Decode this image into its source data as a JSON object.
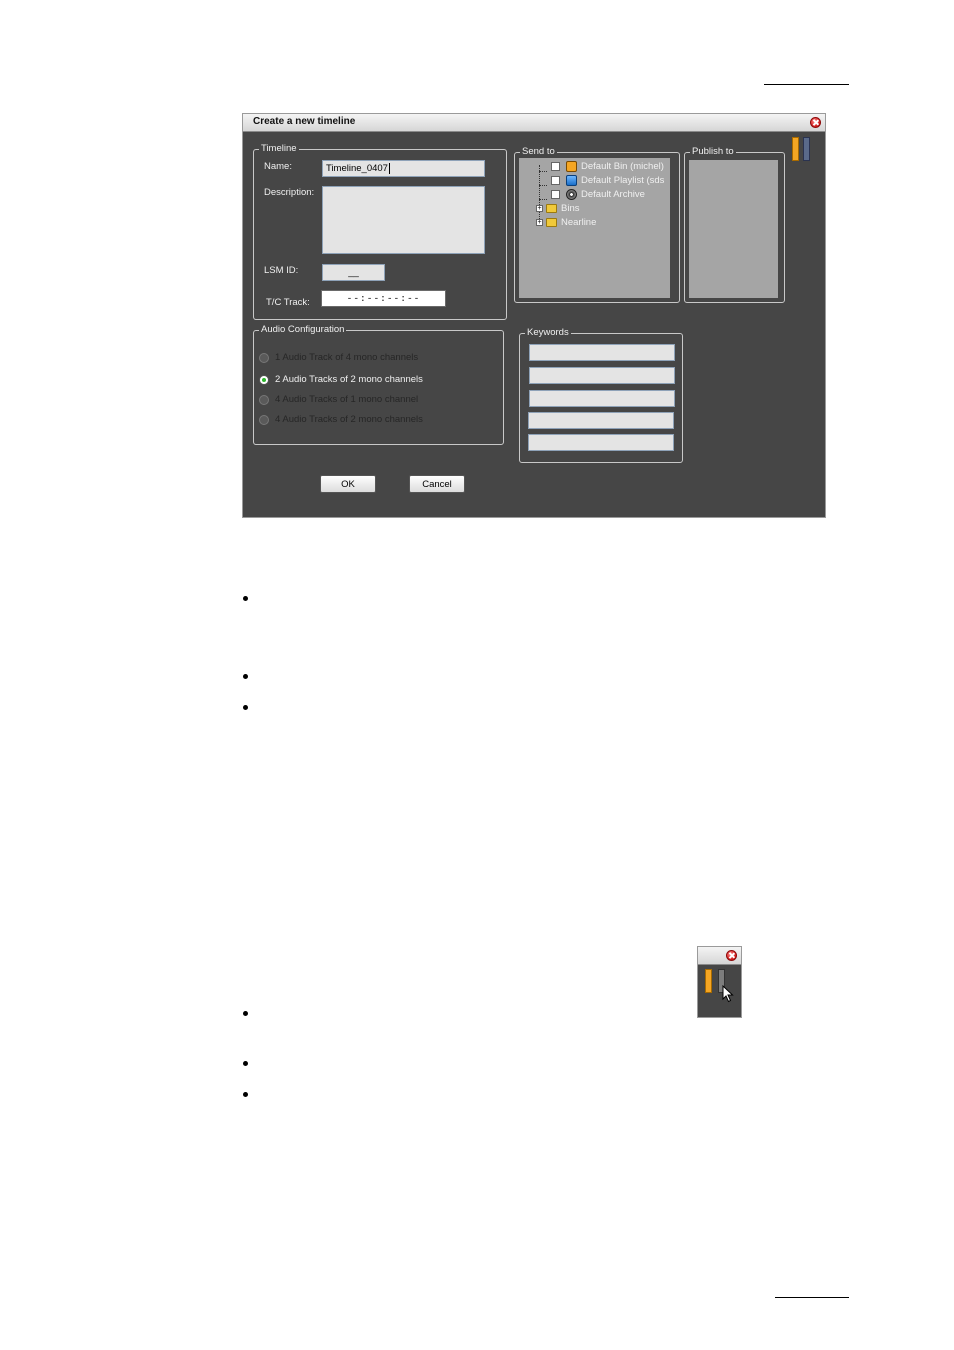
{
  "dialog": {
    "title": "Create a new timeline",
    "timeline_group": {
      "legend": "Timeline",
      "name_label": "Name:",
      "name_value": "Timeline_0407",
      "description_label": "Description:",
      "description_value": "",
      "lsm_id_label": "LSM ID:",
      "lsm_id_value": "__",
      "tc_track_label": "T/C Track:",
      "tc_track_value": "--:--:--:--"
    },
    "send_to": {
      "legend": "Send to",
      "items": [
        {
          "label": "Default Bin (michel)",
          "icon": "bin-icon"
        },
        {
          "label": "Default Playlist (sds",
          "icon": "playlist-icon"
        },
        {
          "label": "Default Archive",
          "icon": "archive-icon"
        },
        {
          "label": "Bins",
          "icon": "folder-icon"
        },
        {
          "label": "Nearline",
          "icon": "folder-icon"
        }
      ]
    },
    "publish_to": {
      "legend": "Publish to"
    },
    "audio_config": {
      "legend": "Audio Configuration",
      "options": [
        {
          "label": "1 Audio Track of 4 mono channels",
          "selected": false
        },
        {
          "label": "2 Audio Tracks of 2 mono channels",
          "selected": true
        },
        {
          "label": "4 Audio Tracks of 1 mono channel",
          "selected": false
        },
        {
          "label": "4 Audio Tracks of 2 mono channels",
          "selected": false
        }
      ]
    },
    "keywords": {
      "legend": "Keywords",
      "fields": [
        "",
        "",
        "",
        "",
        ""
      ]
    },
    "buttons": {
      "ok": "OK",
      "cancel": "Cancel"
    },
    "colors": {
      "background": "#464646",
      "gauge_orange": "#f5a623",
      "gauge_blue": "#5a6a8a",
      "selected_radio": "#2db82d"
    }
  }
}
